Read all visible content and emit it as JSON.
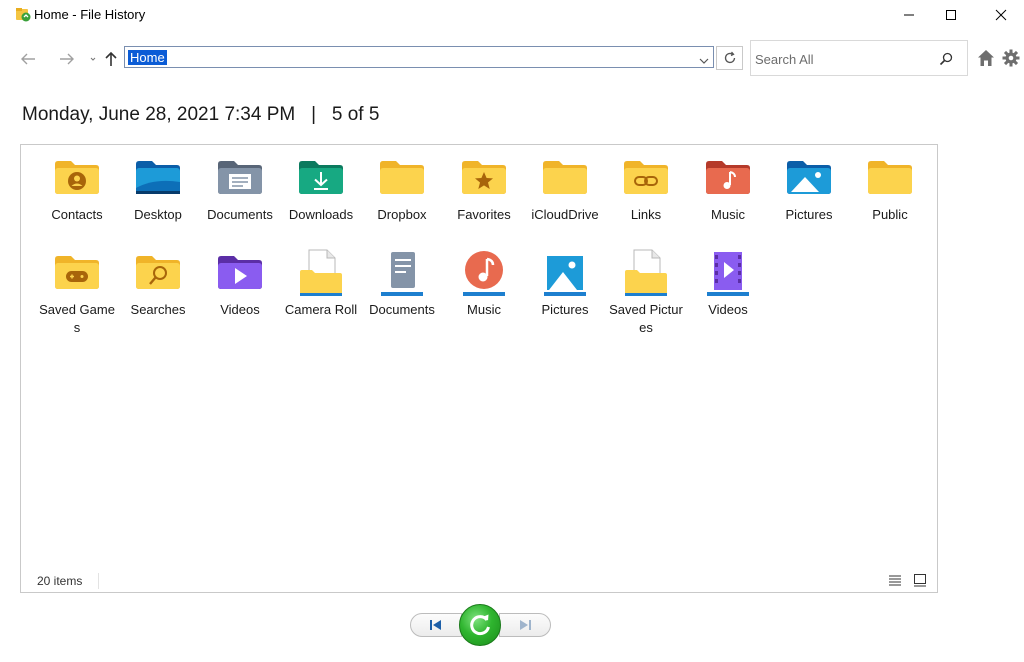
{
  "window": {
    "title": "Home - File History",
    "colors": {
      "accent": "#0b5cd6",
      "restore_green": "#2fb52f"
    }
  },
  "nav": {
    "address": "Home",
    "search_placeholder": "Search All"
  },
  "header": {
    "date": "Monday, June 28, 2021 7:34 PM",
    "separator": "|",
    "position": "5 of 5"
  },
  "items": [
    {
      "label": "Contacts",
      "icon": "folder-contacts-icon"
    },
    {
      "label": "Desktop",
      "icon": "folder-desktop-icon"
    },
    {
      "label": "Documents",
      "icon": "folder-documents-icon"
    },
    {
      "label": "Downloads",
      "icon": "folder-downloads-icon"
    },
    {
      "label": "Dropbox",
      "icon": "folder-icon"
    },
    {
      "label": "Favorites",
      "icon": "folder-favorites-icon"
    },
    {
      "label": "iCloudDrive",
      "icon": "folder-icon"
    },
    {
      "label": "Links",
      "icon": "folder-links-icon"
    },
    {
      "label": "Music",
      "icon": "folder-music-icon"
    },
    {
      "label": "Pictures",
      "icon": "folder-pictures-icon"
    },
    {
      "label": "Public",
      "icon": "folder-icon"
    },
    {
      "label": "Saved Games",
      "icon": "folder-games-icon"
    },
    {
      "label": "Searches",
      "icon": "folder-searches-icon"
    },
    {
      "label": "Videos",
      "icon": "folder-videos-icon"
    },
    {
      "label": "Camera Roll",
      "icon": "library-camera-roll-icon"
    },
    {
      "label": "Documents",
      "icon": "library-documents-icon"
    },
    {
      "label": "Music",
      "icon": "library-music-icon"
    },
    {
      "label": "Pictures",
      "icon": "library-pictures-icon"
    },
    {
      "label": "Saved Pictures",
      "icon": "library-saved-pictures-icon"
    },
    {
      "label": "Videos",
      "icon": "library-videos-icon"
    }
  ],
  "status": {
    "count": "20 items"
  }
}
